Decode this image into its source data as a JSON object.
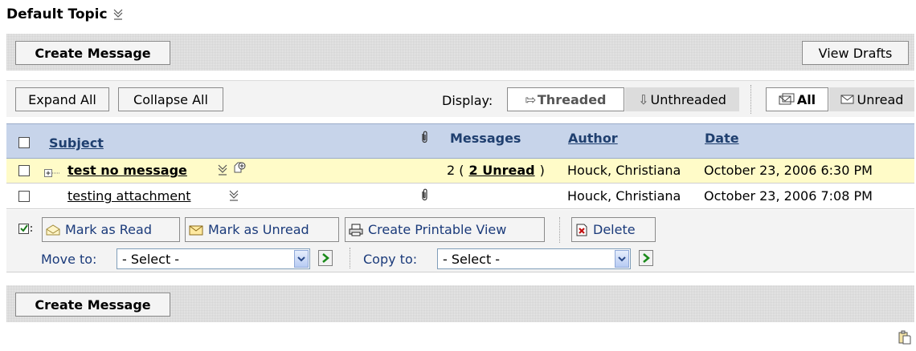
{
  "topic": {
    "title": "Default Topic"
  },
  "toolbar_top": {
    "create_message": "Create Message",
    "view_drafts": "View Drafts"
  },
  "toolbar": {
    "expand_all": "Expand All",
    "collapse_all": "Collapse All",
    "display_label": "Display:",
    "threaded": "Threaded",
    "unthreaded": "Unthreaded",
    "all": "All",
    "unread": "Unread"
  },
  "table": {
    "columns": {
      "subject": "Subject",
      "messages": "Messages",
      "author": "Author",
      "date": "Date"
    },
    "rows": [
      {
        "subject": "test no message",
        "messages_count": "2 (",
        "unread_link": "2 Unread",
        "messages_close": ")",
        "author": "Houck, Christiana",
        "date": "October 23, 2006 6:30 PM"
      },
      {
        "subject": "testing attachment",
        "author": "Houck, Christiana",
        "date": "October 23, 2006 7:08 PM"
      }
    ]
  },
  "actions": {
    "mark_read": "Mark as Read",
    "mark_unread": "Mark as Unread",
    "printable": "Create Printable View",
    "delete": "Delete",
    "move_label": "Move to:",
    "move_value": "- Select -",
    "copy_label": "Copy to:",
    "copy_value": "- Select -"
  },
  "toolbar_bottom": {
    "create_message": "Create Message"
  },
  "colors": {
    "header_row_bg": "#c7d4ea",
    "highlight_row_bg": "#fffbc8",
    "header_link": "#1f3f6f",
    "action_text": "#1a3a7a"
  }
}
